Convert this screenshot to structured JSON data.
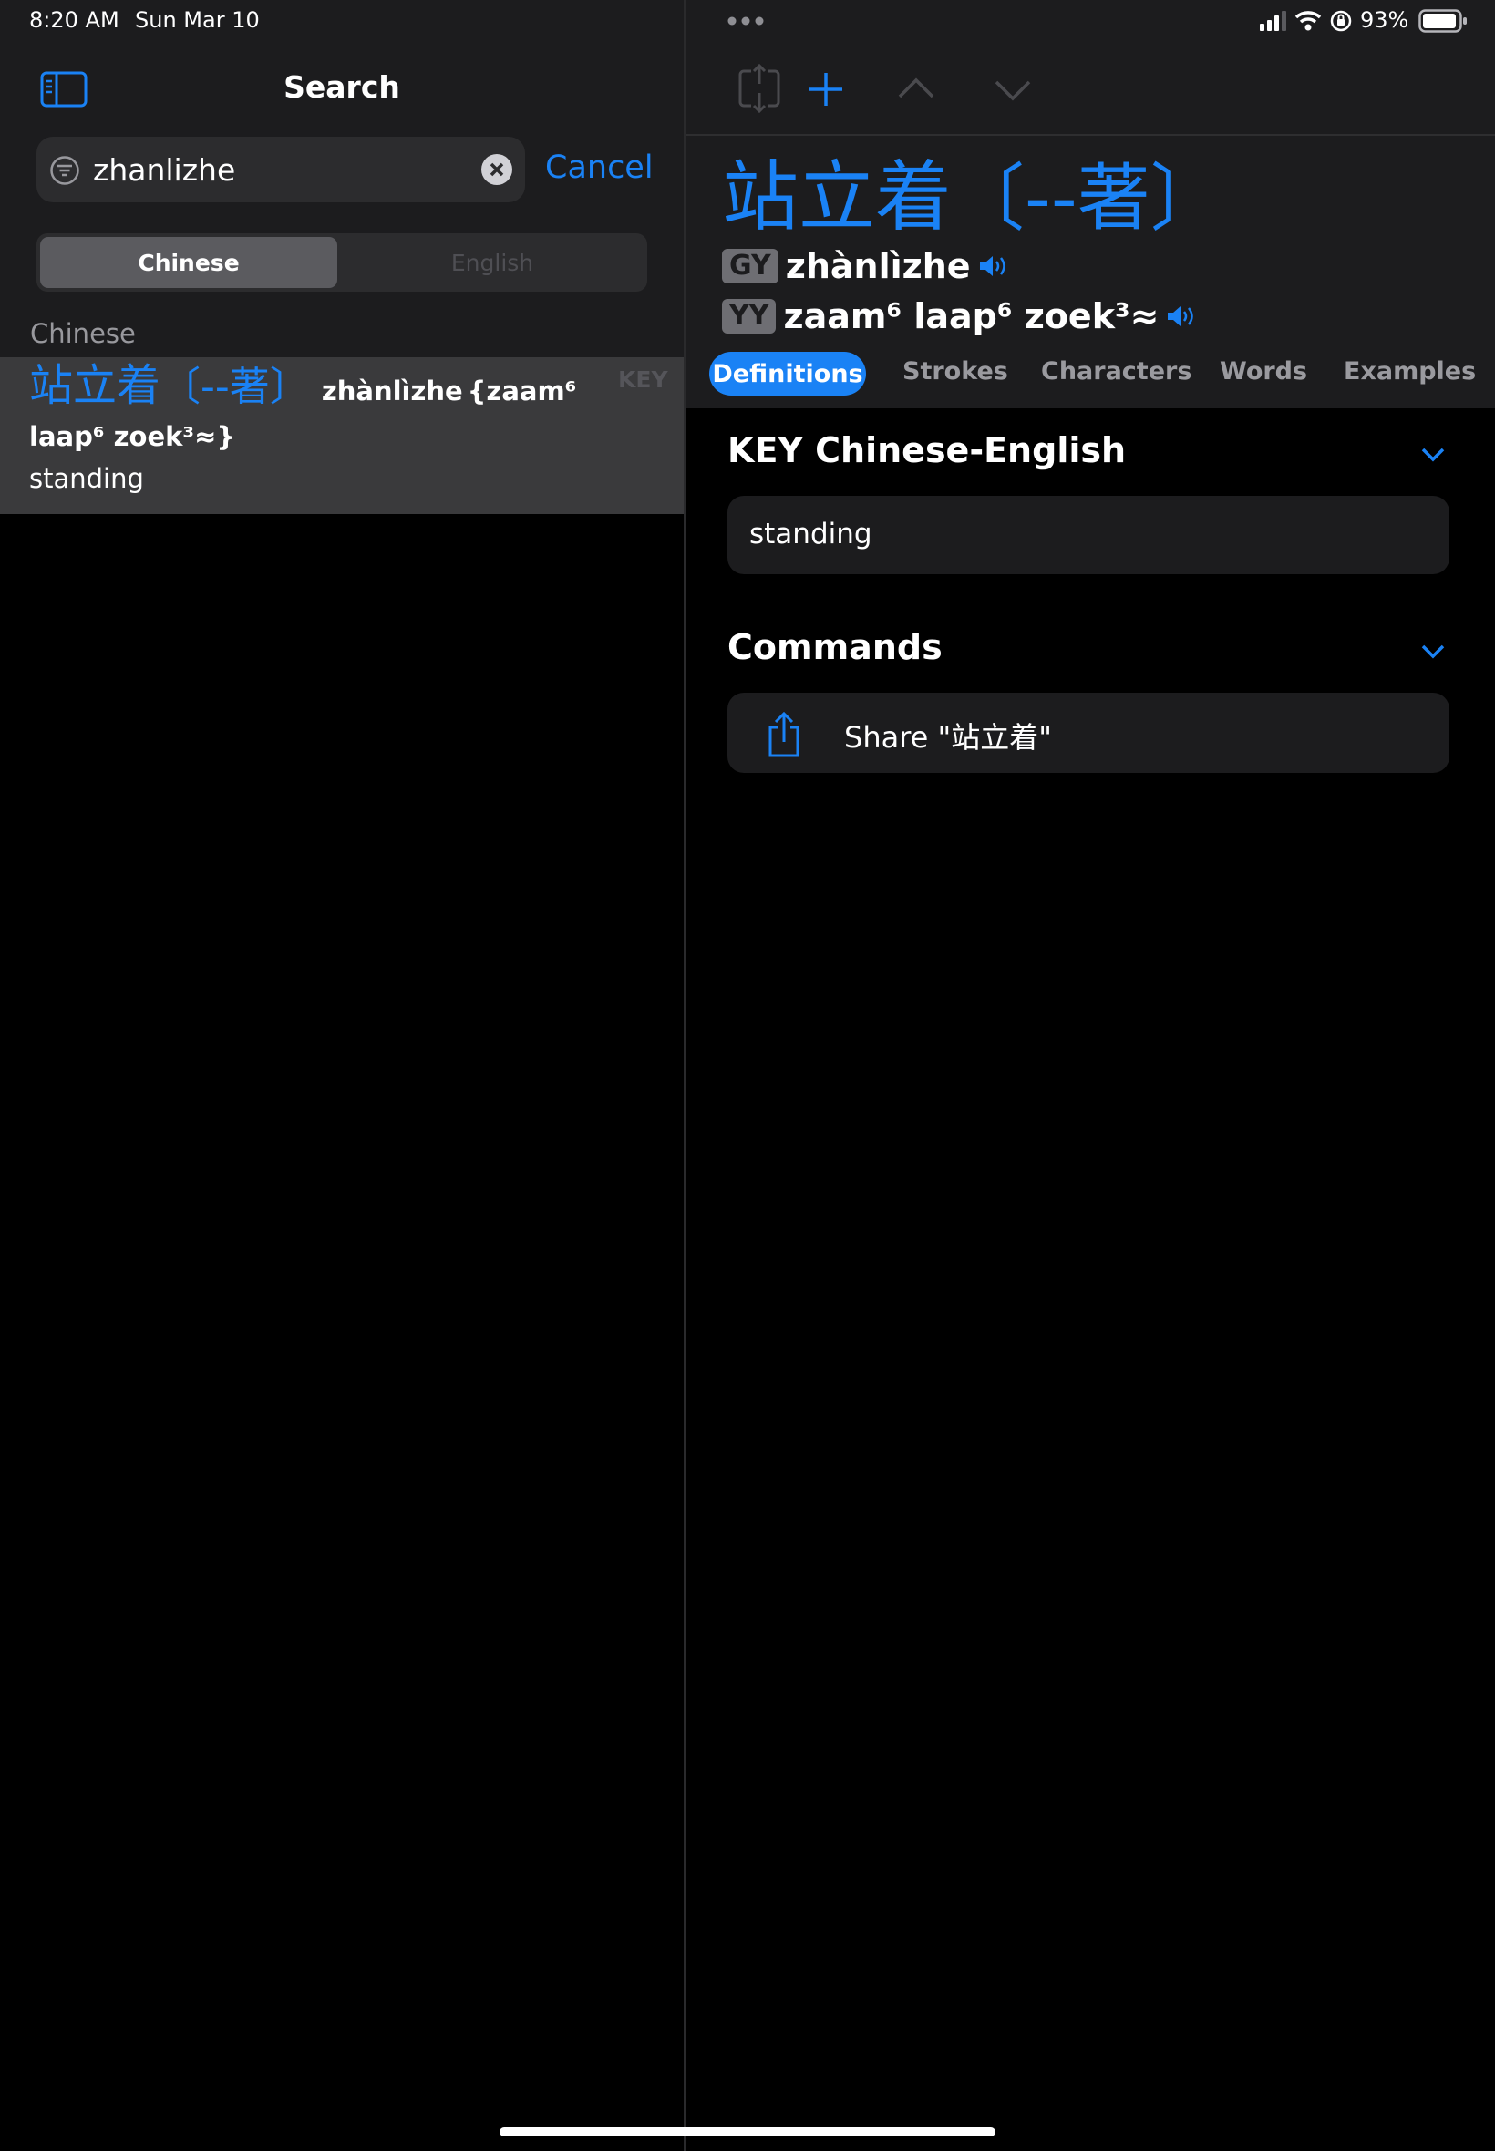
{
  "status_bar": {
    "time": "8:20 AM",
    "date": "Sun Mar 10",
    "battery": "93%"
  },
  "sidebar": {
    "title": "Search",
    "search": {
      "value": "zhanlizhe",
      "cancel": "Cancel"
    },
    "segments": {
      "chinese": "Chinese",
      "english": "English"
    },
    "section_header": "Chinese",
    "result": {
      "hanzi": "站立着",
      "variant": "〔--著〕",
      "pinyin": "zhànlìzhe",
      "jyutping_line1": "{zaam⁶",
      "jyutping_line2": "laap⁶ zoek³≈}",
      "definition": "standing",
      "source_tag": "KEY"
    }
  },
  "entry": {
    "hanzi": "站立着",
    "variant": "〔--著〕",
    "gy_label": "GY",
    "pinyin": "zhànlìzhe",
    "yy_label": "YY",
    "jyutping": "zaam⁶ laap⁶ zoek³≈",
    "tabs": [
      "Definitions",
      "Strokes",
      "Characters",
      "Words",
      "Examples"
    ],
    "definitions_section": "KEY Chinese-English",
    "definition": "standing",
    "commands_section": "Commands",
    "share_label": "Share \"站立着\""
  },
  "colors": {
    "accent": "#1a82f5",
    "background": "#000000",
    "panel": "#1c1c1e"
  },
  "icons": [
    "sidebar-toggle-icon",
    "filter-icon",
    "clear-icon",
    "multitask-dots-icon",
    "signal-icon",
    "wifi-icon",
    "orientation-lock-icon",
    "battery-icon",
    "swap-icon",
    "plus-icon",
    "chevron-up-icon",
    "chevron-down-icon",
    "speaker-icon",
    "share-icon"
  ]
}
